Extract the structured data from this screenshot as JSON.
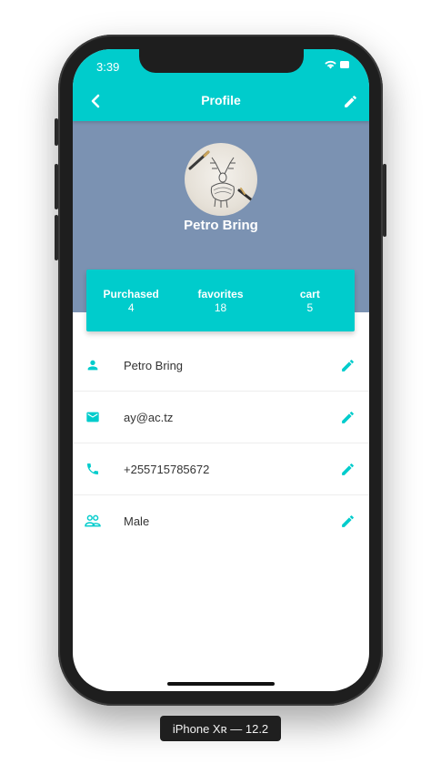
{
  "status_bar": {
    "time": "3:39"
  },
  "appbar": {
    "title": "Profile"
  },
  "profile": {
    "name": "Petro Bring"
  },
  "stats": [
    {
      "label": "Purchased",
      "value": "4"
    },
    {
      "label": "favorites",
      "value": "18"
    },
    {
      "label": "cart",
      "value": "5"
    }
  ],
  "info": [
    {
      "icon": "person-icon",
      "value": "Petro Bring"
    },
    {
      "icon": "email-icon",
      "value": "ay@ac.tz"
    },
    {
      "icon": "phone-icon",
      "value": "+255715785672"
    },
    {
      "icon": "people-icon",
      "value": "Male"
    }
  ],
  "device_label": "iPhone Xʀ — 12.2",
  "colors": {
    "accent": "#00cccc",
    "header_bg": "#7b92b2",
    "text": "#333333"
  }
}
